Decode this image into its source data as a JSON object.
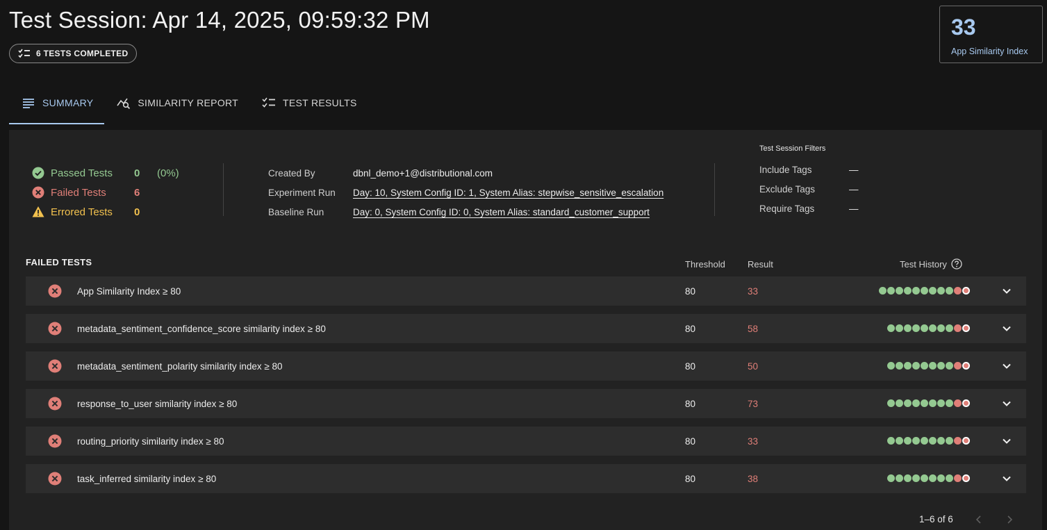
{
  "header": {
    "title": "Test Session: Apr 14, 2025, 09:59:32 PM",
    "badge": "6 TESTS COMPLETED"
  },
  "index_card": {
    "value": "33",
    "label": "App Similarity Index"
  },
  "tabs": [
    {
      "label": "SUMMARY",
      "icon": "lines-icon",
      "active": true
    },
    {
      "label": "SIMILARITY REPORT",
      "icon": "chart-search-icon",
      "active": false
    },
    {
      "label": "TEST RESULTS",
      "icon": "checklist-icon",
      "active": false
    }
  ],
  "stats": {
    "passed": {
      "label": "Passed Tests",
      "count": "0",
      "pct": "(0%)"
    },
    "failed": {
      "label": "Failed Tests",
      "count": "6"
    },
    "errored": {
      "label": "Errored Tests",
      "count": "0"
    }
  },
  "meta": {
    "created_by_label": "Created By",
    "created_by": "dbnl_demo+1@distributional.com",
    "experiment_label": "Experiment Run",
    "experiment": "Day: 10, System Config ID: 1, System Alias: stepwise_sensitive_escalation",
    "baseline_label": "Baseline Run",
    "baseline": "Day: 0, System Config ID: 0, System Alias: standard_customer_support"
  },
  "filters": {
    "title": "Test Session Filters",
    "include_label": "Include Tags",
    "include": "—",
    "exclude_label": "Exclude Tags",
    "exclude": "—",
    "require_label": "Require Tags",
    "require": "—"
  },
  "failed_tests": {
    "title": "FAILED TESTS",
    "col_threshold": "Threshold",
    "col_result": "Result",
    "col_history": "Test History",
    "rows": [
      {
        "name": "App Similarity Index ≥ 80",
        "threshold": "80",
        "result": "33",
        "history": [
          "p",
          "p",
          "p",
          "p",
          "p",
          "p",
          "p",
          "p",
          "p",
          "f",
          "cur"
        ]
      },
      {
        "name": "metadata_sentiment_confidence_score similarity index ≥ 80",
        "threshold": "80",
        "result": "58",
        "history": [
          "p",
          "p",
          "p",
          "p",
          "p",
          "p",
          "p",
          "p",
          "f",
          "cur"
        ]
      },
      {
        "name": "metadata_sentiment_polarity similarity index ≥ 80",
        "threshold": "80",
        "result": "50",
        "history": [
          "p",
          "p",
          "p",
          "p",
          "p",
          "p",
          "p",
          "p",
          "f",
          "cur"
        ]
      },
      {
        "name": "response_to_user similarity index ≥ 80",
        "threshold": "80",
        "result": "73",
        "history": [
          "p",
          "p",
          "p",
          "p",
          "p",
          "p",
          "p",
          "p",
          "f",
          "cur"
        ]
      },
      {
        "name": "routing_priority similarity index ≥ 80",
        "threshold": "80",
        "result": "33",
        "history": [
          "p",
          "p",
          "p",
          "p",
          "p",
          "p",
          "p",
          "p",
          "f",
          "cur"
        ]
      },
      {
        "name": "task_inferred similarity index ≥ 80",
        "threshold": "80",
        "result": "38",
        "history": [
          "p",
          "p",
          "p",
          "p",
          "p",
          "p",
          "p",
          "p",
          "f",
          "cur"
        ]
      }
    ]
  },
  "pager": {
    "range": "1–6 of 6"
  },
  "colors": {
    "accent": "#a8c9ef",
    "pass": "#94c991",
    "fail": "#e07f78",
    "warn": "#f2c14e"
  }
}
